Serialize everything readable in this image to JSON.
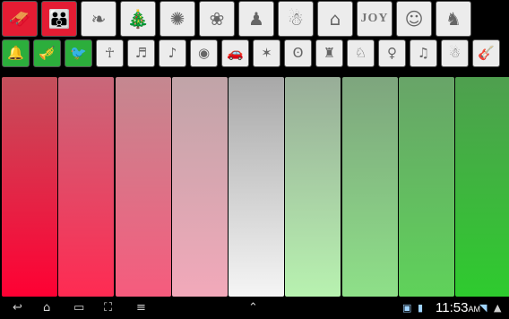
{
  "toolbar_categories": {
    "buttons": [
      {
        "name": "santa-sleigh-icon",
        "glyph": "🛷",
        "state": "selected"
      },
      {
        "name": "carolers-icon",
        "glyph": "👪",
        "state": "selected"
      },
      {
        "name": "holly-icon",
        "glyph": "❧",
        "state": "normal"
      },
      {
        "name": "christmas-tree-icon",
        "glyph": "🎄",
        "state": "normal"
      },
      {
        "name": "fireworks-icon",
        "glyph": "✺",
        "state": "normal"
      },
      {
        "name": "wreath-icon",
        "glyph": "❀",
        "state": "normal"
      },
      {
        "name": "choir-icon",
        "glyph": "♟",
        "state": "normal"
      },
      {
        "name": "snowman-icon",
        "glyph": "☃",
        "state": "normal"
      },
      {
        "name": "snowy-house-icon",
        "glyph": "⌂",
        "state": "normal"
      },
      {
        "name": "joy-text-icon",
        "text": "JOY",
        "state": "normal"
      },
      {
        "name": "elf-icon",
        "glyph": "☺",
        "state": "normal"
      },
      {
        "name": "reindeer-icon",
        "glyph": "♞",
        "state": "normal"
      }
    ]
  },
  "toolbar_instruments": {
    "buttons": [
      {
        "name": "bells-icon",
        "glyph": "🔔",
        "state": "green"
      },
      {
        "name": "trumpet-icon",
        "glyph": "🎺",
        "state": "green"
      },
      {
        "name": "bird-icon",
        "glyph": "🐦",
        "state": "green"
      },
      {
        "name": "angel-icon",
        "glyph": "☥",
        "state": "normal"
      },
      {
        "name": "piano-icon",
        "glyph": "♬",
        "state": "normal"
      },
      {
        "name": "gramophone-icon",
        "glyph": "♪",
        "state": "normal"
      },
      {
        "name": "toy-drum-icon",
        "glyph": "◉",
        "state": "normal"
      },
      {
        "name": "toy-car-icon",
        "glyph": "🚗",
        "state": "normal"
      },
      {
        "name": "gingerbread-man-icon",
        "glyph": "✶",
        "state": "normal"
      },
      {
        "name": "teddy-bear-icon",
        "glyph": "ʘ",
        "state": "normal"
      },
      {
        "name": "toy-soldier-icon",
        "glyph": "♜",
        "state": "normal"
      },
      {
        "name": "fawn-icon",
        "glyph": "♘",
        "state": "normal"
      },
      {
        "name": "girl-icon",
        "glyph": "♀",
        "state": "normal"
      },
      {
        "name": "sleigh-bells-icon",
        "glyph": "♫",
        "state": "normal"
      },
      {
        "name": "snowman-small-icon",
        "glyph": "☃",
        "state": "normal"
      },
      {
        "name": "guitar-icon",
        "glyph": "🎸",
        "state": "normal"
      }
    ]
  },
  "keys": [
    {
      "name": "key-1",
      "top": "#c3505c",
      "bottom": "#ff0033"
    },
    {
      "name": "key-2",
      "top": "#c8687a",
      "bottom": "#ff2a52"
    },
    {
      "name": "key-3",
      "top": "#c48890",
      "bottom": "#f65b7d"
    },
    {
      "name": "key-4",
      "top": "#c0a4a8",
      "bottom": "#f2a9ba"
    },
    {
      "name": "key-5",
      "top": "#a8a8a8",
      "bottom": "#f5f5f5"
    },
    {
      "name": "key-6",
      "top": "#98ad98",
      "bottom": "#b8f2b0"
    },
    {
      "name": "key-7",
      "top": "#7ea57e",
      "bottom": "#8ee088"
    },
    {
      "name": "key-8",
      "top": "#68a468",
      "bottom": "#5fd25a"
    },
    {
      "name": "key-9",
      "top": "#4f9f4f",
      "bottom": "#2ecb2e"
    }
  ],
  "system_bar": {
    "clock": "11:53",
    "ampm": "AM"
  }
}
